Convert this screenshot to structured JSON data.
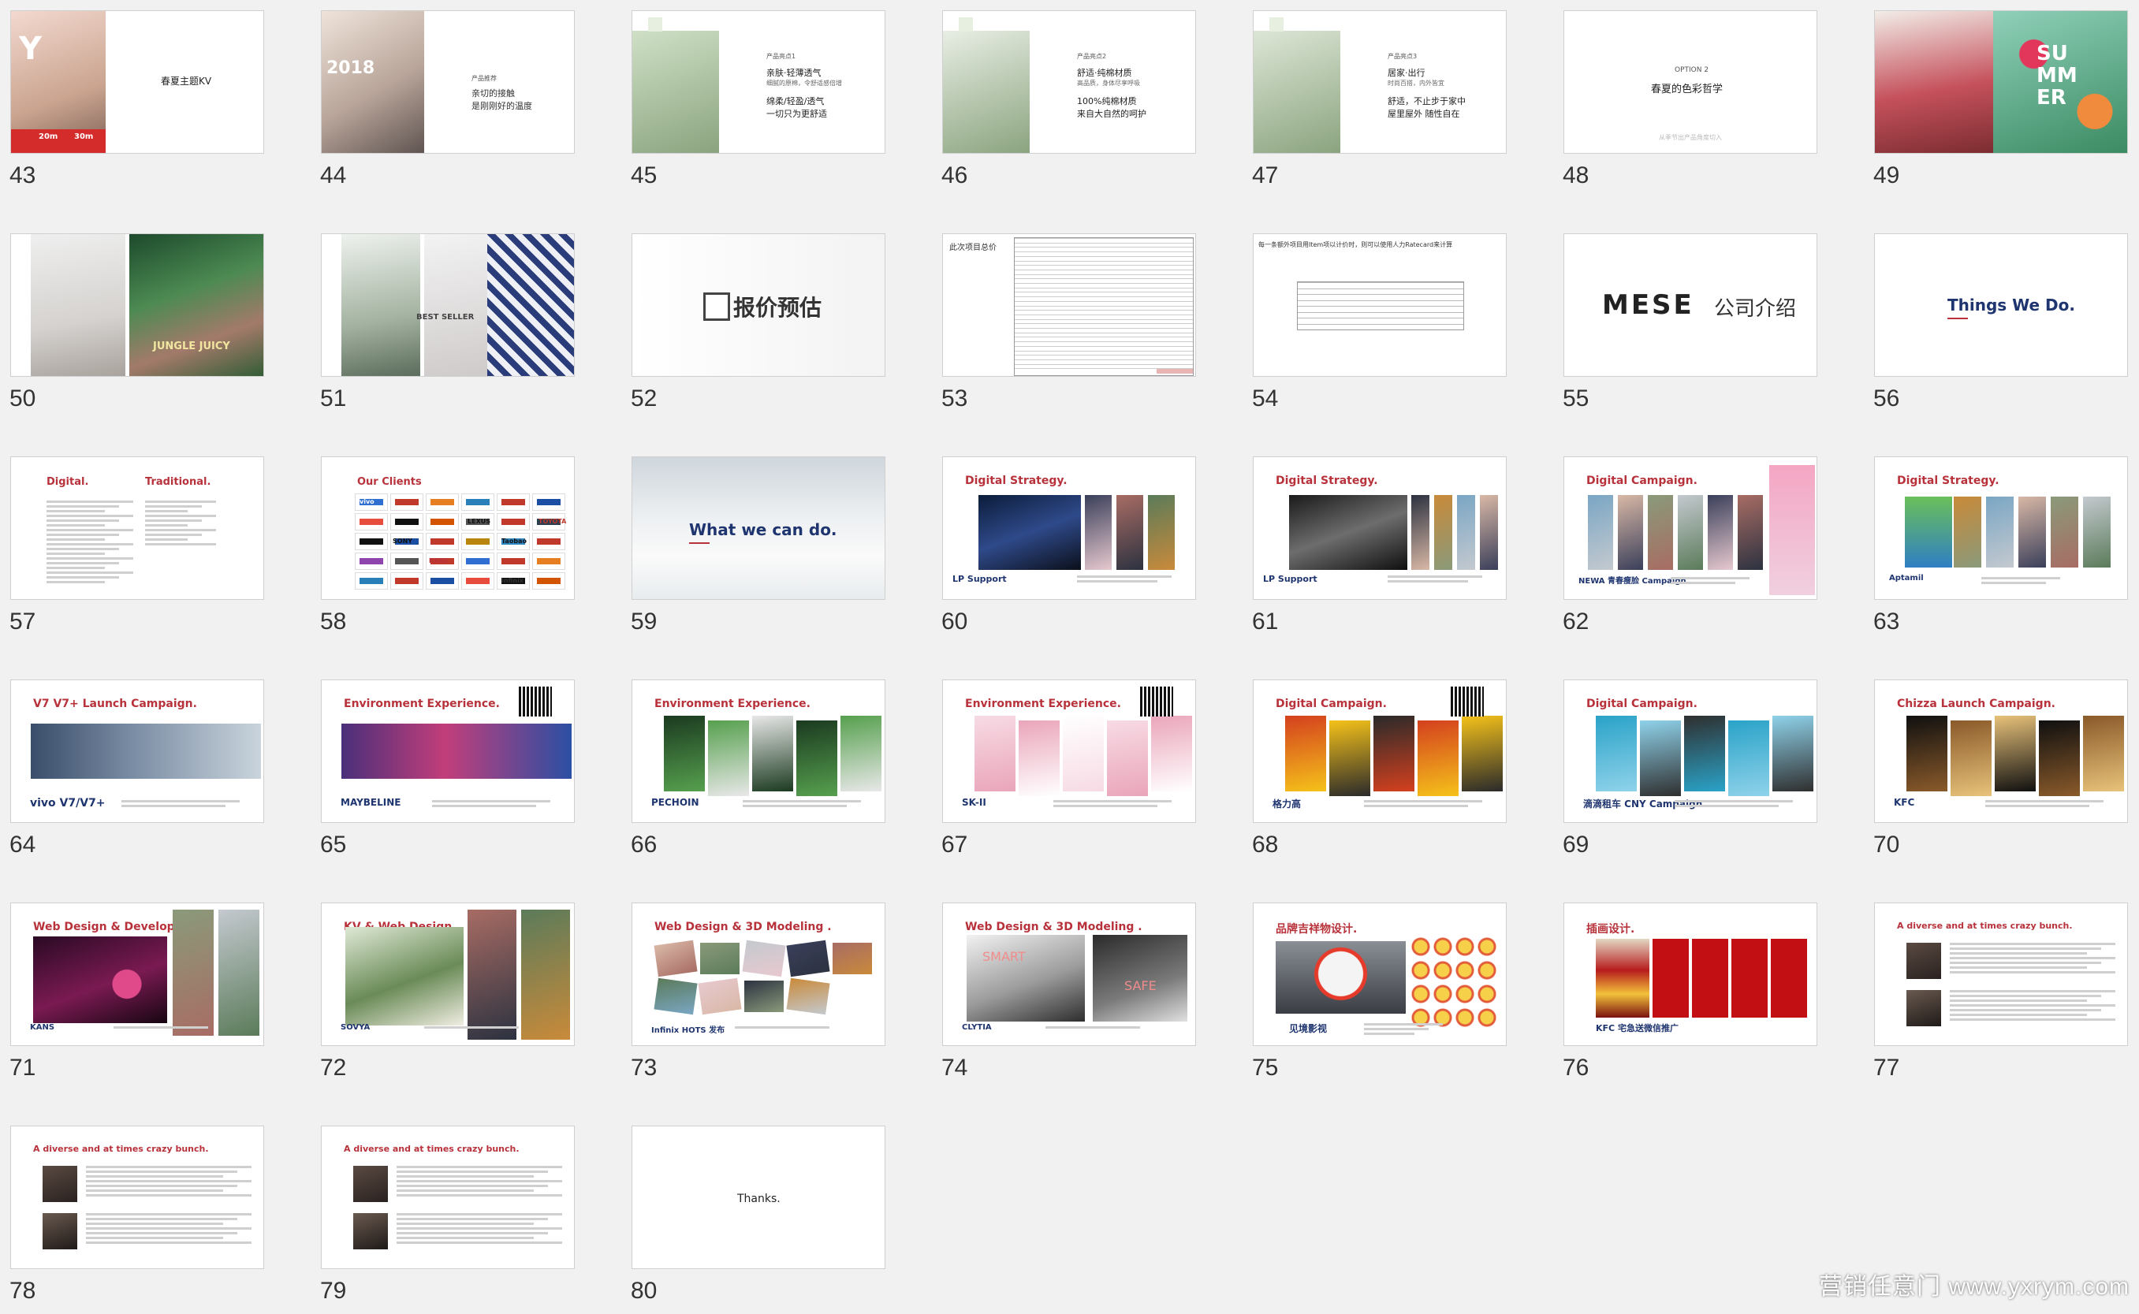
{
  "watermark": "营销任意门 www.yxrym.com",
  "slides": [
    {
      "num": "43",
      "text": "春夏主题KV",
      "sub": [
        "Y",
        "20m",
        "30m"
      ]
    },
    {
      "num": "44",
      "text": "2018",
      "sub": [
        "产品推荐",
        "亲切的接触",
        "是刚刚好的温度"
      ]
    },
    {
      "num": "45",
      "text": "产品亮点1",
      "sub": [
        "亲肤·轻薄透气",
        "细腻的原棉，令舒适感倍增",
        "绵柔/轻盈/透气",
        "一切只为更舒适"
      ]
    },
    {
      "num": "46",
      "text": "产品亮点2",
      "sub": [
        "舒适·纯棉材质",
        "高品质，身体尽享呼吸",
        "100%纯棉材质",
        "来自大自然的呵护"
      ]
    },
    {
      "num": "47",
      "text": "产品亮点3",
      "sub": [
        "居家·出行",
        "时尚百搭，内外皆宜",
        "舒适，不止步于家中",
        "屋里屋外 随性自在"
      ]
    },
    {
      "num": "48",
      "text": "OPTION 2",
      "sub": [
        "春夏的色彩哲学",
        "从季节出产品角度切入"
      ]
    },
    {
      "num": "49",
      "text": "SUMMER",
      "sub": []
    },
    {
      "num": "50",
      "text": "JUNGLE JUICY",
      "sub": []
    },
    {
      "num": "51",
      "text": "BEST SELLER",
      "sub": []
    },
    {
      "num": "52",
      "text": "报价预估",
      "sub": []
    },
    {
      "num": "53",
      "text": "此次项目总价",
      "sub": []
    },
    {
      "num": "54",
      "text": "每一条额外项目用Item项以计价时，则可以使用人力Ratecard来计算",
      "sub": []
    },
    {
      "num": "55",
      "text": "MESE",
      "sub": [
        "公司介绍"
      ]
    },
    {
      "num": "56",
      "text": "Things We Do.",
      "sub": []
    },
    {
      "num": "57",
      "text": "Digital.",
      "sub": [
        "Traditional."
      ]
    },
    {
      "num": "58",
      "text": "Our Clients",
      "sub": [
        "vivo",
        "LEXUS",
        "TOYOTA",
        "SONY",
        "Taobao",
        "KANS",
        "infinix"
      ]
    },
    {
      "num": "59",
      "text": "What we can do.",
      "sub": []
    },
    {
      "num": "60",
      "text": "Digital Strategy.",
      "sub": [
        "LP Support"
      ]
    },
    {
      "num": "61",
      "text": "Digital Strategy.",
      "sub": [
        "LP Support"
      ]
    },
    {
      "num": "62",
      "text": "Digital Campaign.",
      "sub": [
        "NEWA 青春瘦脸 Campaign"
      ]
    },
    {
      "num": "63",
      "text": "Digital Strategy.",
      "sub": [
        "Aptamil"
      ]
    },
    {
      "num": "64",
      "text": "V7 V7+ Launch Campaign.",
      "sub": [
        "vivo  V7/V7+"
      ]
    },
    {
      "num": "65",
      "text": "Environment Experience.",
      "sub": [
        "MAYBELINE"
      ]
    },
    {
      "num": "66",
      "text": "Environment Experience.",
      "sub": [
        "PECHOIN"
      ]
    },
    {
      "num": "67",
      "text": "Environment Experience.",
      "sub": [
        "SK-II"
      ]
    },
    {
      "num": "68",
      "text": "Digital Campaign.",
      "sub": [
        "格力高"
      ]
    },
    {
      "num": "69",
      "text": "Digital Campaign.",
      "sub": [
        "滴滴租车 CNY Campaign"
      ]
    },
    {
      "num": "70",
      "text": "Chizza  Launch Campaign.",
      "sub": [
        "KFC"
      ]
    },
    {
      "num": "71",
      "text": "Web Design & Development.",
      "sub": [
        "KANS"
      ]
    },
    {
      "num": "72",
      "text": "KV & Web Design",
      "sub": [
        "SOVYA"
      ]
    },
    {
      "num": "73",
      "text": "Web Design & 3D Modeling .",
      "sub": [
        "Infinix HOTS 发布"
      ]
    },
    {
      "num": "74",
      "text": "Web Design & 3D Modeling .",
      "sub": [
        "CLYTIA",
        "SMART",
        "SAFE"
      ]
    },
    {
      "num": "75",
      "text": "品牌吉祥物设计.",
      "sub": [
        "见境影视"
      ]
    },
    {
      "num": "76",
      "text": "插画设计.",
      "sub": [
        "KFC 宅急送微信推广"
      ]
    },
    {
      "num": "77",
      "text": "A diverse and at times crazy bunch.",
      "sub": []
    },
    {
      "num": "78",
      "text": "A diverse and at times crazy bunch.",
      "sub": []
    },
    {
      "num": "79",
      "text": "A diverse and at times crazy bunch.",
      "sub": []
    },
    {
      "num": "80",
      "text": "Thanks.",
      "sub": []
    }
  ],
  "colors": {
    "accent_red": "#b8323b",
    "navy": "#1f3570",
    "bg": "#f1f1f1"
  }
}
